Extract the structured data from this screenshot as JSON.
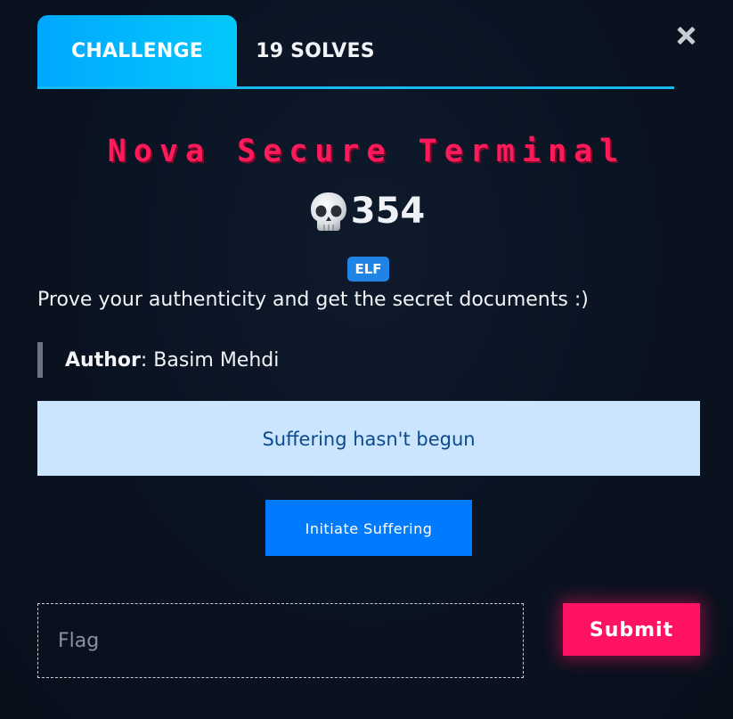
{
  "tabs": {
    "challenge_label": "CHALLENGE",
    "solves_label": "19 SOLVES"
  },
  "challenge": {
    "title": "Nova Secure Terminal",
    "points": "354",
    "points_icon": "skull-icon",
    "tag": "ELF",
    "description": "Prove your authenticity and get the secret documents :)",
    "author_label": "Author",
    "author_name": ": Basim Mehdi"
  },
  "status": {
    "message": "Suffering hasn't begun"
  },
  "actions": {
    "initiate_label": "Initiate Suffering",
    "submit_label": "Submit"
  },
  "flag_input": {
    "placeholder": "Flag",
    "value": ""
  },
  "colors": {
    "accent_blue": "#04c8fb",
    "title_pink": "#ff1a5c",
    "submit_pink": "#ff1262",
    "alert_bg": "#cce5ff",
    "button_blue": "#007bff",
    "tag_blue": "#1f84e6"
  }
}
